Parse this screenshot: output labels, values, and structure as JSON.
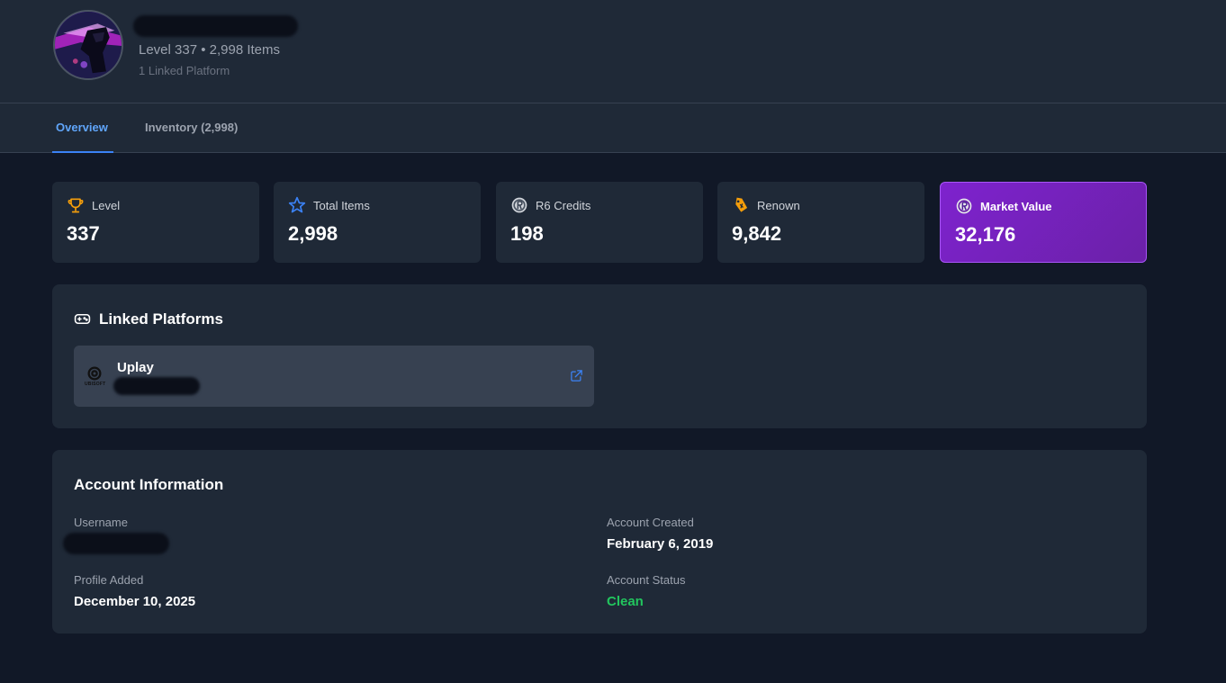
{
  "profile": {
    "summary": "Level 337 • 2,998 Items",
    "linked_count": "1 Linked Platform"
  },
  "tabs": [
    {
      "label": "Overview",
      "active": true
    },
    {
      "label": "Inventory (2,998)",
      "active": false
    }
  ],
  "stats": [
    {
      "label": "Level",
      "value": "337",
      "icon": "trophy-icon"
    },
    {
      "label": "Total Items",
      "value": "2,998",
      "icon": "star-icon"
    },
    {
      "label": "R6 Credits",
      "value": "198",
      "icon": "r6-credits-icon"
    },
    {
      "label": "Renown",
      "value": "9,842",
      "icon": "renown-tag-icon"
    },
    {
      "label": "Market Value",
      "value": "32,176",
      "icon": "r6-credits-icon"
    }
  ],
  "linked_platforms": {
    "title": "Linked Platforms",
    "items": [
      {
        "name": "Uplay",
        "logo_text": "UBISOFT",
        "icon": "external-link-icon"
      }
    ]
  },
  "account_info": {
    "title": "Account Information",
    "username_label": "Username",
    "created_label": "Account Created",
    "created_value": "February 6, 2019",
    "added_label": "Profile Added",
    "added_value": "December 10, 2025",
    "status_label": "Account Status",
    "status_value": "Clean"
  },
  "colors": {
    "page_bg": "#111827",
    "card_bg": "#1f2937",
    "accent_blue": "#60a5fa",
    "market_purple": "#7e22ce",
    "status_green": "#22c55e"
  }
}
